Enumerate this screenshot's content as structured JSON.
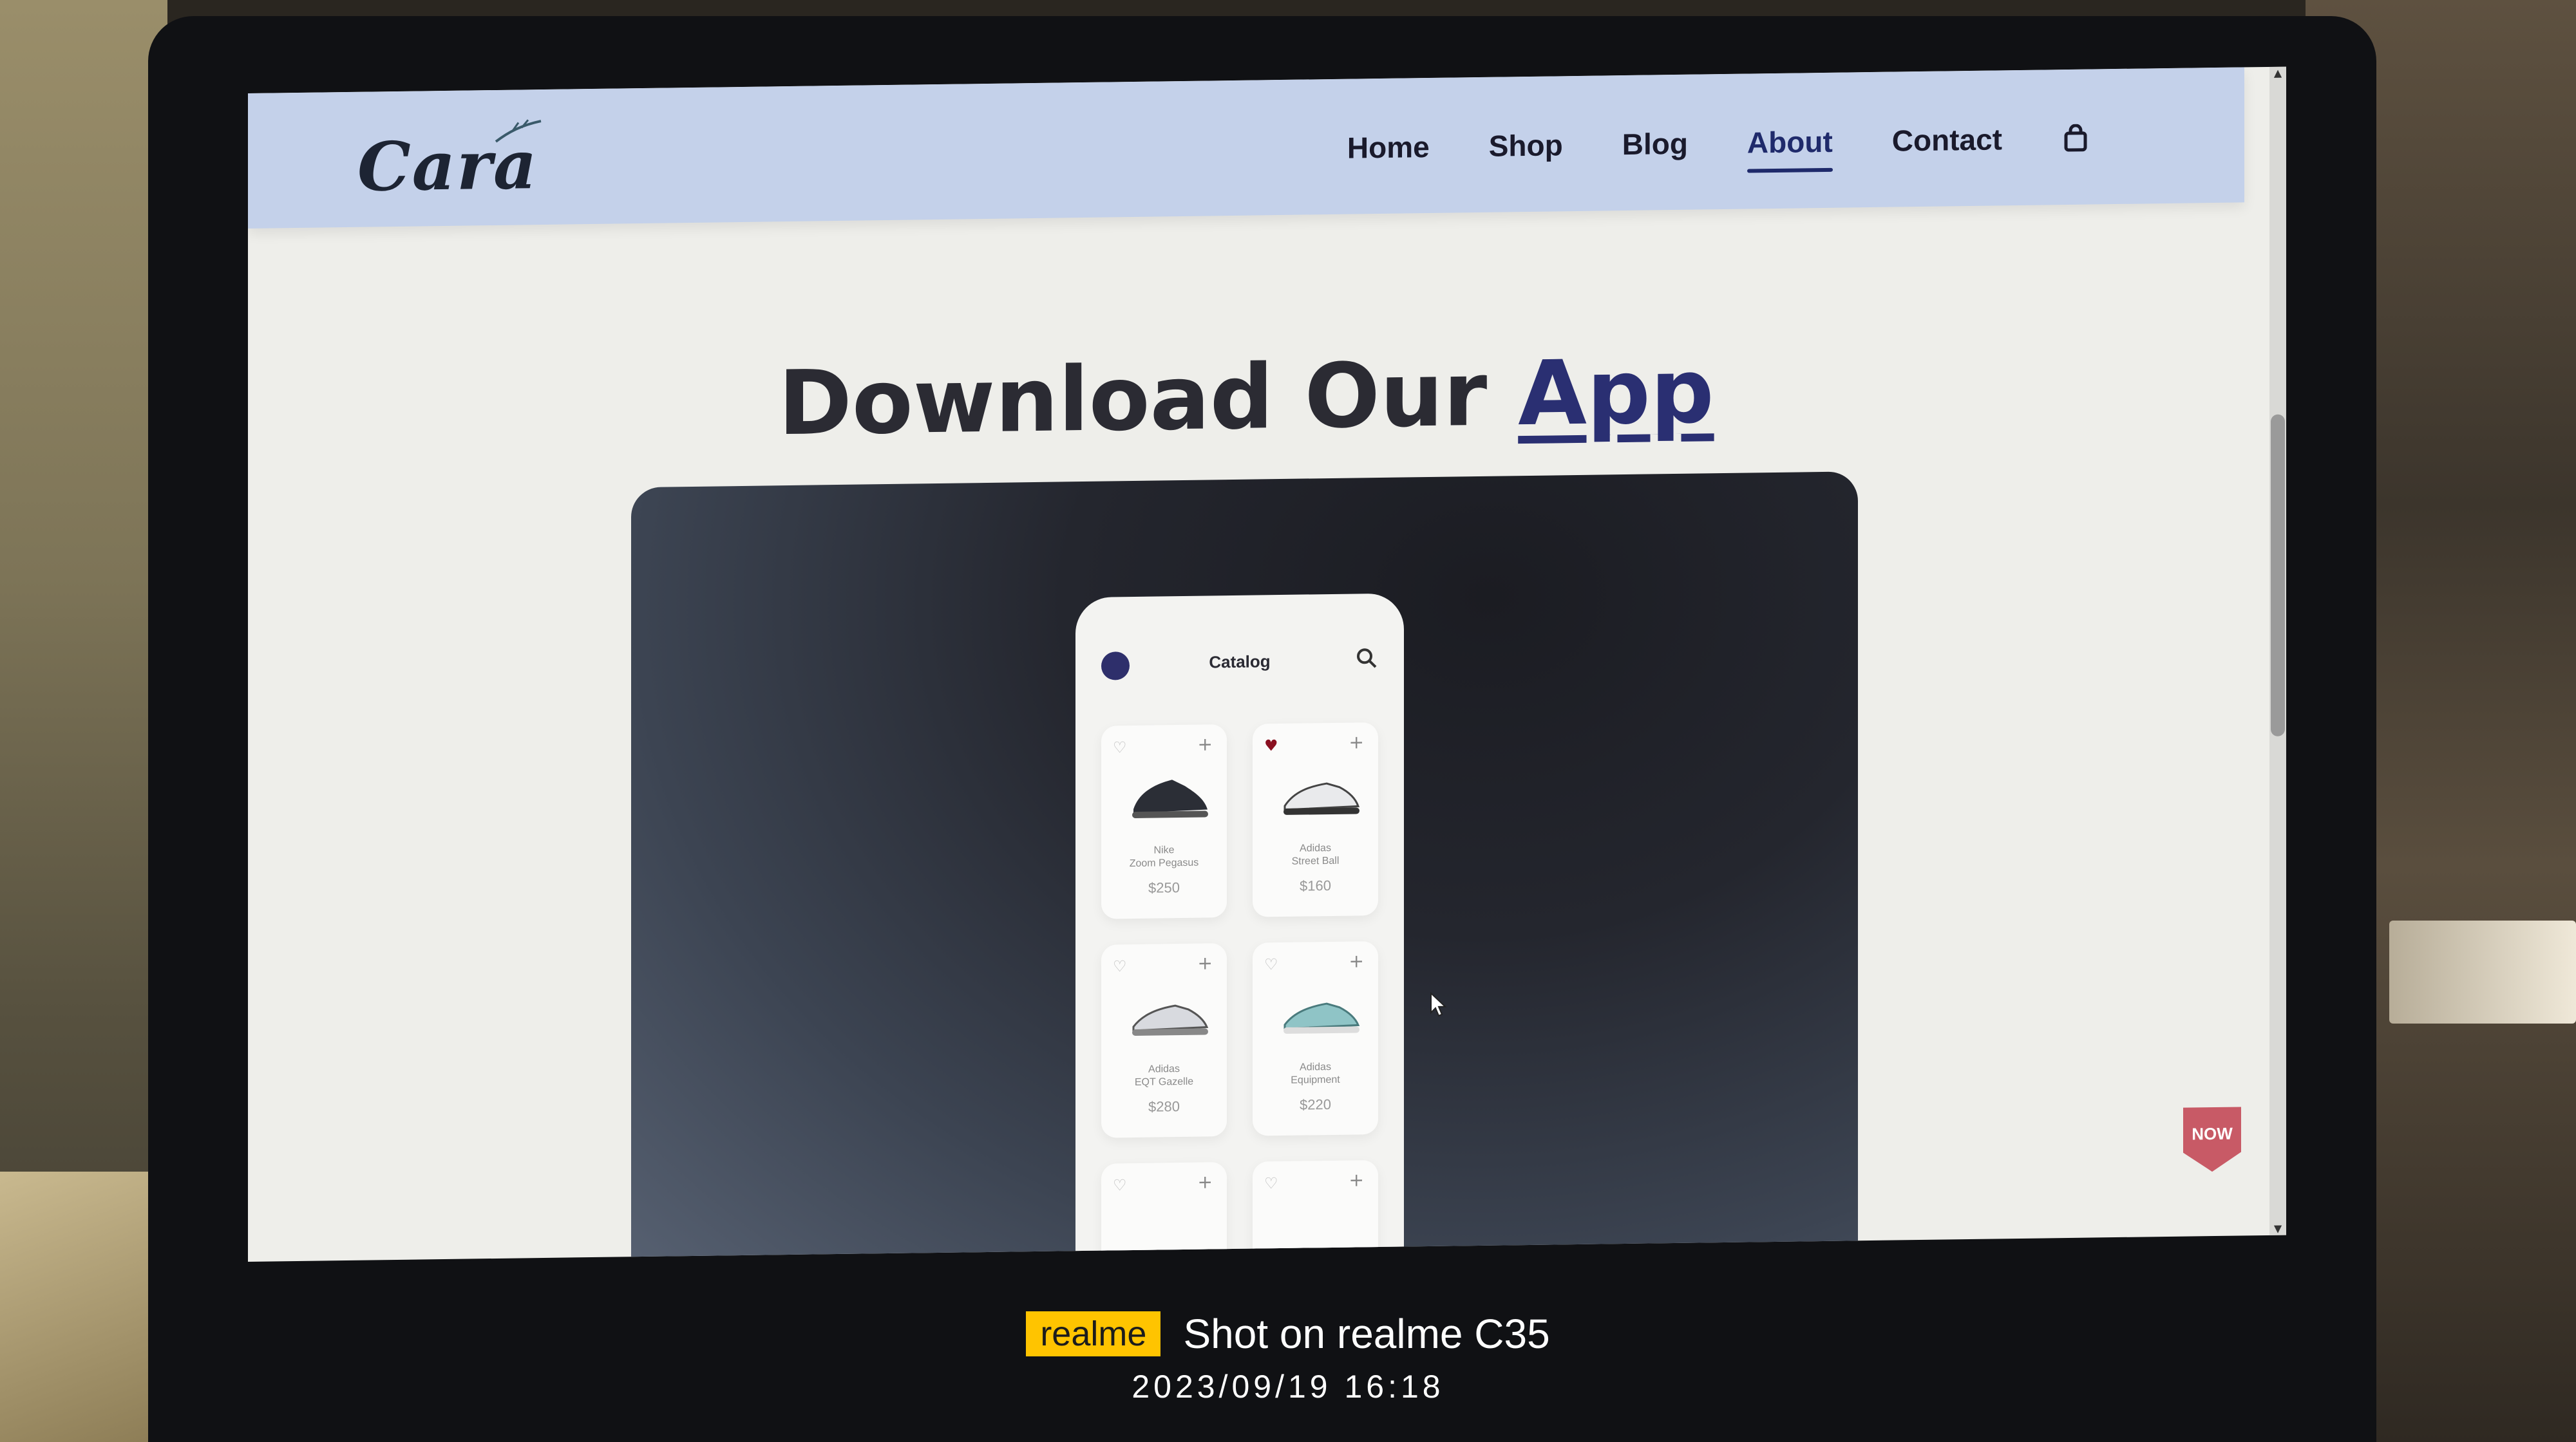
{
  "site": {
    "logo_text": "Cara",
    "nav_items": [
      "Home",
      "Shop",
      "Blog",
      "About",
      "Contact"
    ],
    "active_nav": "About",
    "accent_color": "#2a2f72",
    "navbar_color": "#c4d1ea"
  },
  "section": {
    "heading_main": "Download Our",
    "heading_accent": "App"
  },
  "phone_app": {
    "title": "Catalog",
    "products": [
      {
        "name_line1": "Nike",
        "name_line2": "Zoom Pegasus",
        "price": "$250",
        "favorite": false
      },
      {
        "name_line1": "Adidas",
        "name_line2": "Street Ball",
        "price": "$160",
        "favorite": true
      },
      {
        "name_line1": "Adidas",
        "name_line2": "EQT Gazelle",
        "price": "$280",
        "favorite": false
      },
      {
        "name_line1": "Adidas",
        "name_line2": "Equipment",
        "price": "$220",
        "favorite": false
      }
    ]
  },
  "badge_text": "NOW",
  "camera_watermark": {
    "brand": "realme",
    "text": "Shot on realme C35",
    "datetime": "2023/09/19  16:18"
  }
}
